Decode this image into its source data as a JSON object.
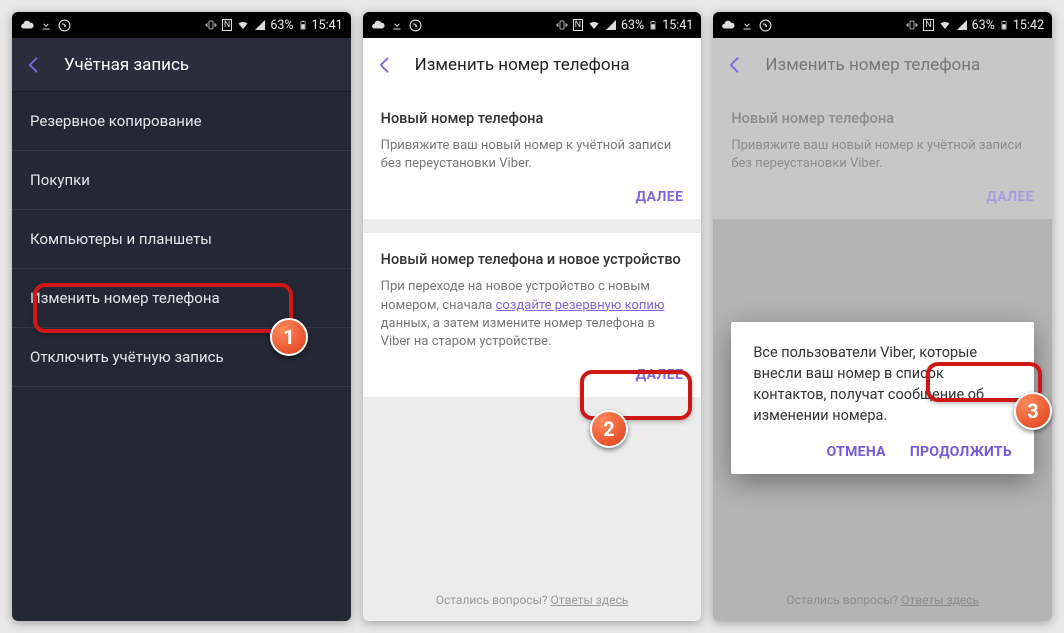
{
  "statusbar": {
    "battery": "63%",
    "time1": "15:41",
    "time2": "15:41",
    "time3": "15:42",
    "icons": {
      "cloud": "cloud-upload-icon",
      "download": "download-icon",
      "viber": "viber-icon",
      "vibrate": "vibrate-icon",
      "nfc": "nfc-icon",
      "wifi": "wifi-icon",
      "signal": "signal-icon"
    }
  },
  "screen1": {
    "title": "Учётная запись",
    "items": [
      "Резервное копирование",
      "Покупки",
      "Компьютеры и планшеты",
      "Изменить номер телефона",
      "Отключить учётную запись"
    ]
  },
  "screen2": {
    "title": "Изменить номер телефона",
    "card1": {
      "title": "Новый номер телефона",
      "text": "Привяжите ваш новый номер к учётной записи без переустановки Viber.",
      "action": "ДАЛЕЕ"
    },
    "card2": {
      "title": "Новый номер телефона и новое устройство",
      "text_pre": "При переходе на новое устройство с новым номером, сначала ",
      "link": "создайте резервную копию",
      "text_post": " данных, а затем измените номер телефона в Viber на старом устройстве.",
      "action": "ДАЛЕЕ"
    },
    "footer": {
      "q": "Остались вопросы? ",
      "a": "Ответы здесь"
    }
  },
  "screen3": {
    "title": "Изменить номер телефона",
    "dialog": {
      "text": "Все пользователи Viber, которые внесли ваш номер в список контактов, получат сообщение об изменении номера.",
      "cancel": "ОТМЕНА",
      "ok": "ПРОДОЛЖИТЬ"
    }
  },
  "badges": {
    "b1": "1",
    "b2": "2",
    "b3": "3"
  }
}
